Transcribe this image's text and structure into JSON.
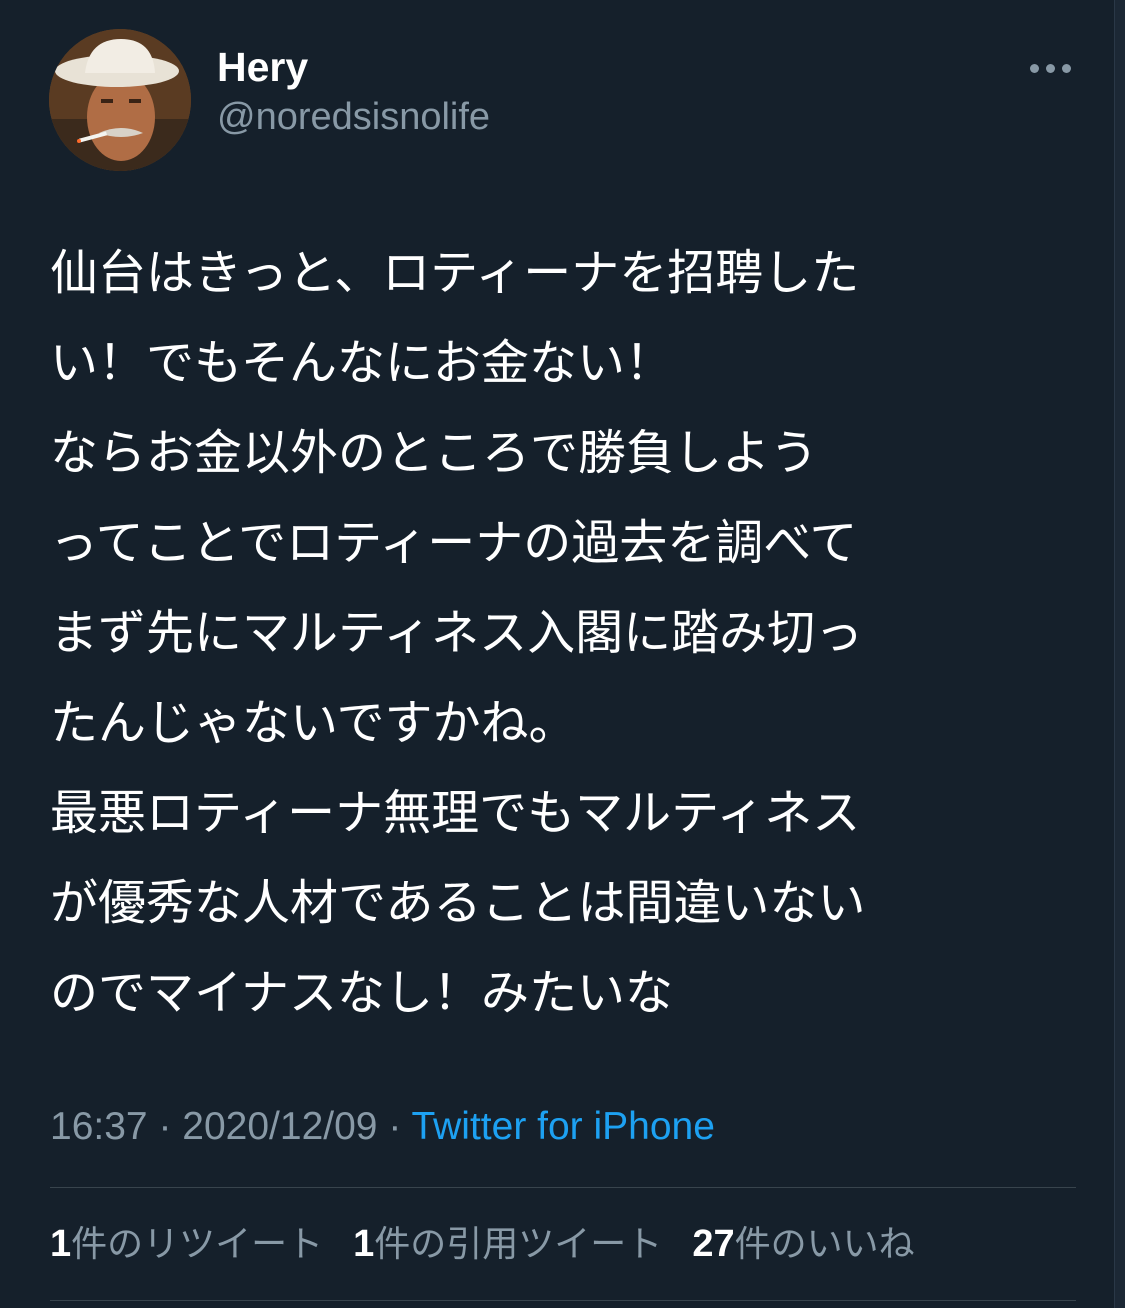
{
  "user": {
    "display_name": "Hery",
    "handle": "@noredsisnolife",
    "avatar_icon": "profile-photo-man-with-cowboy-hat"
  },
  "more_icon": "more-dots-icon",
  "tweet": {
    "lines": [
      "仙台はきっと、ロティーナを招聘した",
      "い！でもそんなにお金ない！",
      "ならお金以外のところで勝負しよう",
      "ってことでロティーナの過去を調べて",
      "まず先にマルティネス入閣に踏み切っ",
      "たんじゃないですかね。",
      "最悪ロティーナ無理でもマルティネス",
      "が優秀な人材であることは間違いない",
      "のでマイナスなし！みたいな"
    ]
  },
  "meta": {
    "time": "16:37",
    "separator": " · ",
    "date": "2020/12/09",
    "source": "Twitter for iPhone"
  },
  "stats": {
    "retweets": {
      "count": "1",
      "label": "件のリツイート"
    },
    "quotes": {
      "count": "1",
      "label": "件の引用ツイート"
    },
    "likes": {
      "count": "27",
      "label": "件のいいね"
    }
  },
  "colors": {
    "background": "#15202b",
    "text_primary": "#ffffff",
    "text_secondary": "#8899a6",
    "link": "#1da1f2",
    "divider": "#38444d"
  }
}
